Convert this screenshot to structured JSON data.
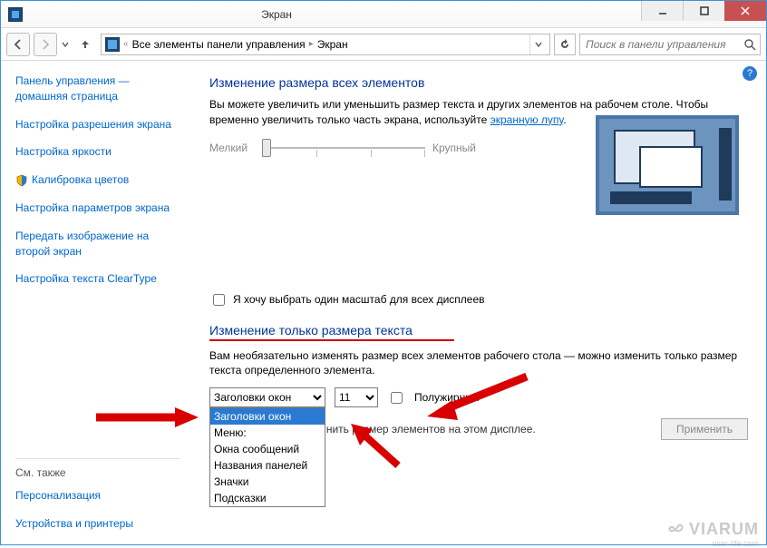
{
  "window": {
    "title": "Экран"
  },
  "toolbar": {
    "breadcrumb": {
      "root_prefix": "«",
      "item1": "Все элементы панели управления",
      "item2": "Экран"
    },
    "search_placeholder": "Поиск в панели управления"
  },
  "sidebar": {
    "links": [
      "Панель управления — домашняя страница",
      "Настройка разрешения экрана",
      "Настройка яркости",
      "Калибровка цветов",
      "Настройка параметров экрана",
      "Передать изображение на второй экран",
      "Настройка текста ClearType"
    ],
    "see_also_heading": "См. также",
    "see_also": [
      "Персонализация",
      "Устройства и принтеры"
    ]
  },
  "main": {
    "section1_title": "Изменение размера всех элементов",
    "section1_desc_part1": "Вы можете увеличить или уменьшить размер текста и других элементов на рабочем столе. Чтобы временно увеличить только часть экрана, используйте ",
    "section1_link": "экранную лупу",
    "section1_desc_part2": ".",
    "slider_small": "Мелкий",
    "slider_large": "Крупный",
    "checkbox_single_scale": "Я хочу выбрать один масштаб для всех дисплеев",
    "section2_title": "Изменение только размера текста",
    "section2_desc": "Вам необязательно изменять размер всех элементов рабочего стола — можно изменить только размер текста определенного элемента.",
    "element_selected": "Заголовки окон",
    "font_size_selected": "11",
    "bold_checkbox": "Полужирный",
    "dropdown_options": [
      "Заголовки окон",
      "Меню:",
      "Окна сообщений",
      "Названия панелей",
      "Значки",
      "Подсказки"
    ],
    "bottom_info": "нить размер элементов на этом дисплее.",
    "apply_button": "Применить"
  },
  "watermark": {
    "brand": "VIARUM",
    "sub": "user-life.com"
  }
}
